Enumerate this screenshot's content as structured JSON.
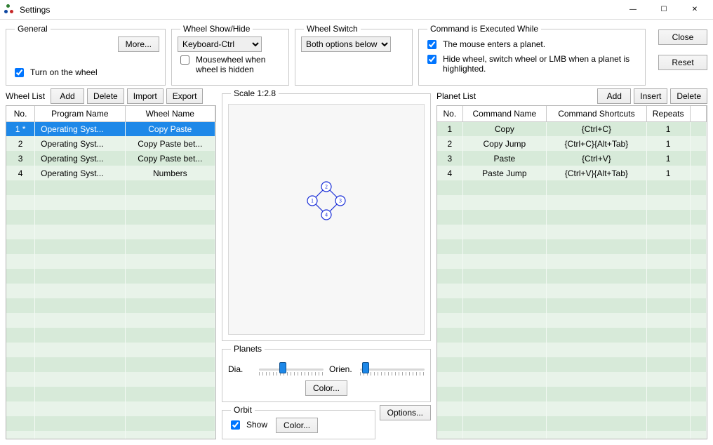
{
  "window": {
    "title": "Settings",
    "btn_min": "—",
    "btn_max": "☐",
    "btn_close": "✕"
  },
  "top": {
    "general": {
      "legend": "General",
      "more_btn": "More...",
      "turn_on_label": "Turn on the wheel",
      "turn_on_checked": true
    },
    "showhide": {
      "legend": "Wheel Show/Hide",
      "combo_value": "Keyboard-Ctrl",
      "mousewheel_label": "Mousewheel when wheel is hidden",
      "mousewheel_checked": false
    },
    "switch": {
      "legend": "Wheel Switch",
      "combo_value": "Both options below"
    },
    "executed": {
      "legend": "Command is Executed While",
      "opt1_label": "The mouse enters a planet.",
      "opt1_checked": true,
      "opt2_label": "Hide wheel, switch wheel or LMB when a planet is highlighted.",
      "opt2_checked": true
    },
    "close_btn": "Close",
    "reset_btn": "Reset"
  },
  "wheel_list": {
    "label": "Wheel List",
    "add_btn": "Add",
    "delete_btn": "Delete",
    "import_btn": "Import",
    "export_btn": "Export",
    "col_no": "No.",
    "col_program": "Program Name",
    "col_wheel": "Wheel Name",
    "rows": [
      {
        "no": "1 *",
        "program": "Operating Syst...",
        "wheel": "Copy Paste",
        "selected": true
      },
      {
        "no": "2",
        "program": "Operating Syst...",
        "wheel": "Copy Paste bet..."
      },
      {
        "no": "3",
        "program": "Operating Syst...",
        "wheel": "Copy Paste bet..."
      },
      {
        "no": "4",
        "program": "Operating Syst...",
        "wheel": "Numbers"
      }
    ]
  },
  "mid": {
    "scale_legend": "Scale 1:2.8",
    "planets_legend": "Planets",
    "dia_label": "Dia.",
    "orien_label": "Orien.",
    "color_btn": "Color...",
    "orbit_legend": "Orbit",
    "show_label": "Show",
    "show_checked": true,
    "options_btn": "Options...",
    "planet_labels": {
      "p1": "1",
      "p2": "2",
      "p3": "3",
      "p4": "4"
    }
  },
  "planet_list": {
    "label": "Planet List",
    "add_btn": "Add",
    "insert_btn": "Insert",
    "delete_btn": "Delete",
    "col_no": "No.",
    "col_cmd": "Command Name",
    "col_short": "Command Shortcuts",
    "col_rep": "Repeats",
    "rows": [
      {
        "no": "1",
        "cmd": "Copy",
        "short": "{Ctrl+C}",
        "rep": "1"
      },
      {
        "no": "2",
        "cmd": "Copy Jump",
        "short": "{Ctrl+C}{Alt+Tab}",
        "rep": "1"
      },
      {
        "no": "3",
        "cmd": "Paste",
        "short": "{Ctrl+V}",
        "rep": "1"
      },
      {
        "no": "4",
        "cmd": "Paste Jump",
        "short": "{Ctrl+V}{Alt+Tab}",
        "rep": "1"
      }
    ]
  }
}
